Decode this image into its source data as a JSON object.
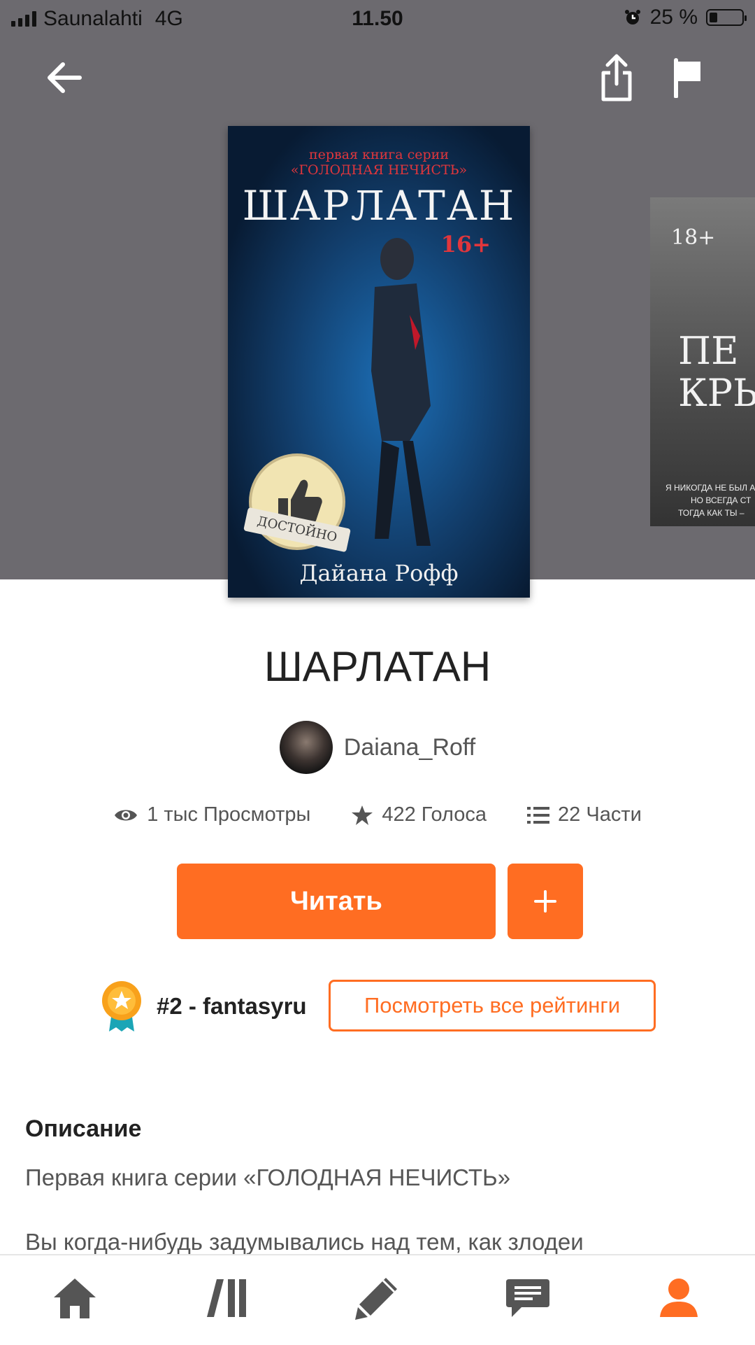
{
  "status_bar": {
    "carrier": "Saunalahti",
    "network": "4G",
    "time": "11.50",
    "battery": "25 %",
    "battery_level": 0.25
  },
  "toolbar": {
    "back_icon": "arrow-left-icon",
    "share_icon": "share-icon",
    "report_icon": "flag-icon"
  },
  "cover": {
    "series_line1": "первая книга серии",
    "series_line2": "«ГОЛОДНАЯ НЕЧИСТЬ»",
    "title": "ШАРЛАТАН",
    "age_rating": "16+",
    "author": "Дайана Рофф",
    "badge_text": "ДОСТОЙНО"
  },
  "next_cover": {
    "age_rating": "18+",
    "title_line1": "ПЕ",
    "title_line2": "КРЫ",
    "text_line1": "Я НИКОГДА НЕ БЫЛ АНГ",
    "text_line2": "НО ВСЕГДА СТ",
    "text_line3": "ТОГДА КАК ТЫ –"
  },
  "book": {
    "title": "ШАРЛАТАН",
    "author_name": "Daiana_Roff",
    "views": "1 тыс Просмотры",
    "votes": "422 Голоса",
    "parts": "22 Части"
  },
  "actions": {
    "read_label": "Читать",
    "add_icon": "plus-icon"
  },
  "ranking": {
    "rank_text": "#2 - fantasyru",
    "view_all_label": "Посмотреть все рейтинги"
  },
  "description": {
    "heading": "Описание",
    "line1": "Первая книга серии «ГОЛОДНАЯ НЕЧИСТЬ»",
    "line2": "Вы когда-нибудь задумывались над тем, как злодеи"
  },
  "colors": {
    "accent": "#ff6d22",
    "hero_bg": "#6c6a6f"
  }
}
